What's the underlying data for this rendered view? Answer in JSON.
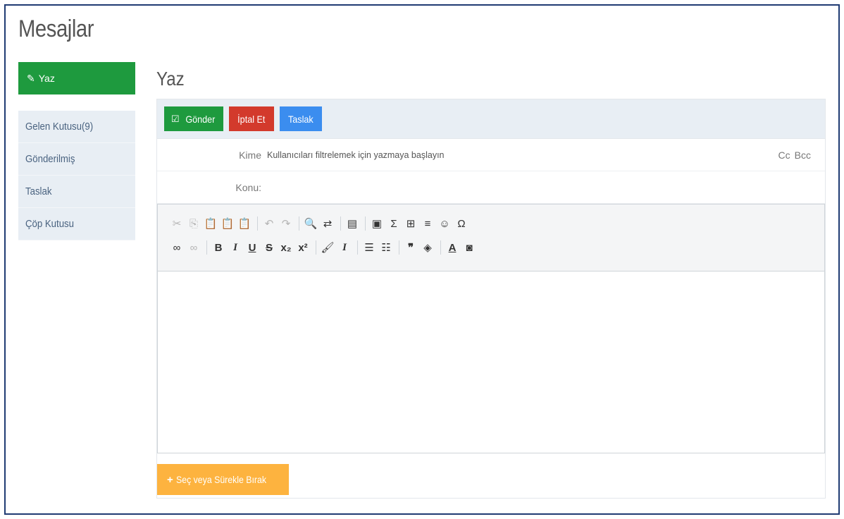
{
  "app": {
    "title": "Mesajlar"
  },
  "sidebar": {
    "compose_label": "Yaz",
    "folders": [
      {
        "label": "Gelen Kutusu(9)"
      },
      {
        "label": "Gönderilmiş"
      },
      {
        "label": "Taslak"
      },
      {
        "label": "Çöp Kutusu"
      }
    ]
  },
  "main": {
    "heading": "Yaz",
    "actions": {
      "send": "Gönder",
      "cancel": "İptal Et",
      "draft": "Taslak"
    },
    "to": {
      "label": "Kime",
      "placeholder": "Kullanıcıları filtrelemek için yazmaya başlayın",
      "cc": "Cc",
      "bcc": "Bcc"
    },
    "subject": {
      "label": "Konu:",
      "value": ""
    },
    "upload_label": "Seç veya Sürekle Bırak"
  },
  "editor": {
    "toolbar_row1": [
      "cut-icon",
      "copy-icon",
      "paste-icon",
      "paste-text-icon",
      "paste-word-icon",
      "undo-icon",
      "redo-icon",
      "find-icon",
      "replace-icon",
      "templates-icon",
      "image-icon",
      "formula-icon",
      "table-icon",
      "horizontal-line-icon",
      "smiley-icon",
      "special-char-icon"
    ],
    "toolbar_row2": [
      "link-icon",
      "unlink-icon",
      "bold-icon",
      "italic-icon",
      "underline-icon",
      "strikethrough-icon",
      "subscript-icon",
      "superscript-icon",
      "copy-format-icon",
      "remove-format-icon",
      "numbered-list-icon",
      "bulleted-list-icon",
      "blockquote-icon",
      "div-container-icon",
      "text-color-icon",
      "background-color-icon"
    ]
  },
  "colors": {
    "green": "#1e9a3e",
    "red": "#d33a2c",
    "blue": "#3b8def",
    "orange": "#fdb33f",
    "frame": "#1f3b73"
  }
}
